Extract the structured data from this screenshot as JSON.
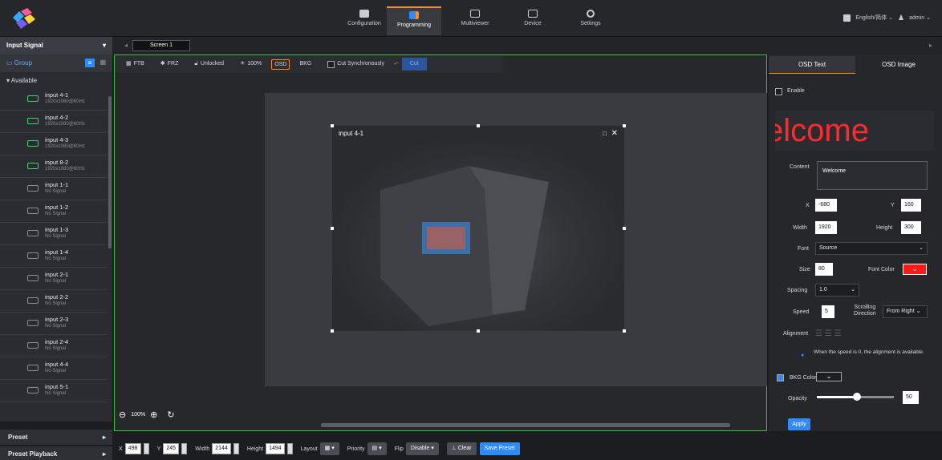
{
  "top_nav": {
    "tabs": [
      {
        "label": "Configuration"
      },
      {
        "label": "Programming"
      },
      {
        "label": "Multiviewer"
      },
      {
        "label": "Device"
      },
      {
        "label": "Settings"
      }
    ],
    "language": "English/简体",
    "user": "admin"
  },
  "left": {
    "section_title": "Input Signal",
    "group_label": "Group",
    "available_label": "Available",
    "sources": [
      {
        "name": "input 4-1",
        "status": "1920x1080@60Hz"
      },
      {
        "name": "input 4-2",
        "status": "1920x1080@60Hz"
      },
      {
        "name": "input 4-3",
        "status": "1920x1080@60Hz"
      },
      {
        "name": "input 8-2",
        "status": "1920x1080@60Hz"
      },
      {
        "name": "input 1-1",
        "status": "No Signal"
      },
      {
        "name": "input 1-2",
        "status": "No Signal"
      },
      {
        "name": "input 1-3",
        "status": "No Signal"
      },
      {
        "name": "input 1-4",
        "status": "No Signal"
      },
      {
        "name": "input 2-1",
        "status": "No Signal"
      },
      {
        "name": "input 2-2",
        "status": "No Signal"
      },
      {
        "name": "input 2-3",
        "status": "No Signal"
      },
      {
        "name": "input 2-4",
        "status": "No Signal"
      },
      {
        "name": "input 4-4",
        "status": "No Signal"
      },
      {
        "name": "input 5-1",
        "status": "No Signal"
      }
    ],
    "preset": "Preset",
    "preset_playback": "Preset Playback"
  },
  "screen_tab": "Screen 1",
  "toolbar": {
    "ftb": "FTB",
    "frz": "FRZ",
    "lock": "Unlocked",
    "brightness": "100%",
    "osd": "OSD",
    "bkg": "BKG",
    "cut_sync": "Cut Synchronously",
    "cut": "Cut"
  },
  "window": {
    "title": "input 4-1"
  },
  "zoom": "100%",
  "bottom": {
    "x_label": "X",
    "x": "498",
    "y_label": "Y",
    "y": "245",
    "width_label": "Width",
    "width": "2144",
    "height_label": "Height",
    "height": "1494",
    "layout_label": "Layout",
    "priority_label": "Priority",
    "flip_label": "Flip",
    "flip": "Disable",
    "clear": "Clear",
    "save_preset": "Save Preset"
  },
  "right": {
    "tab_text": "OSD Text",
    "tab_image": "OSD Image",
    "enable": "Enable",
    "preview_text": "elcome",
    "content_label": "Content",
    "content": "Welcome",
    "x_label": "X",
    "x": "-680",
    "y_label": "Y",
    "y": "160",
    "width_label": "Width",
    "width": "1920",
    "height_label": "Height",
    "height": "300",
    "font_label": "Font",
    "font": "Source",
    "size_label": "Size",
    "size": "80",
    "font_color_label": "Font Color",
    "spacing_label": "Spacing",
    "spacing": "1.0",
    "speed_label": "Speed",
    "speed": "5",
    "scroll_dir_label_1": "Scrolling",
    "scroll_dir_label_2": "Direction",
    "scroll_dir": "From Right",
    "alignment_label": "Alignment",
    "alignment_note": "When the speed is 0, the alignment is available.",
    "bkg_color": "BKG Color",
    "opacity_label": "Opacity",
    "opacity": "50",
    "opacity_level": 0.5,
    "apply": "Apply"
  },
  "colors": {
    "accent": "#ff8a1e",
    "blue": "#2e8bff",
    "font_color": "#ff1a1a",
    "frame_green": "#3dc13d"
  }
}
